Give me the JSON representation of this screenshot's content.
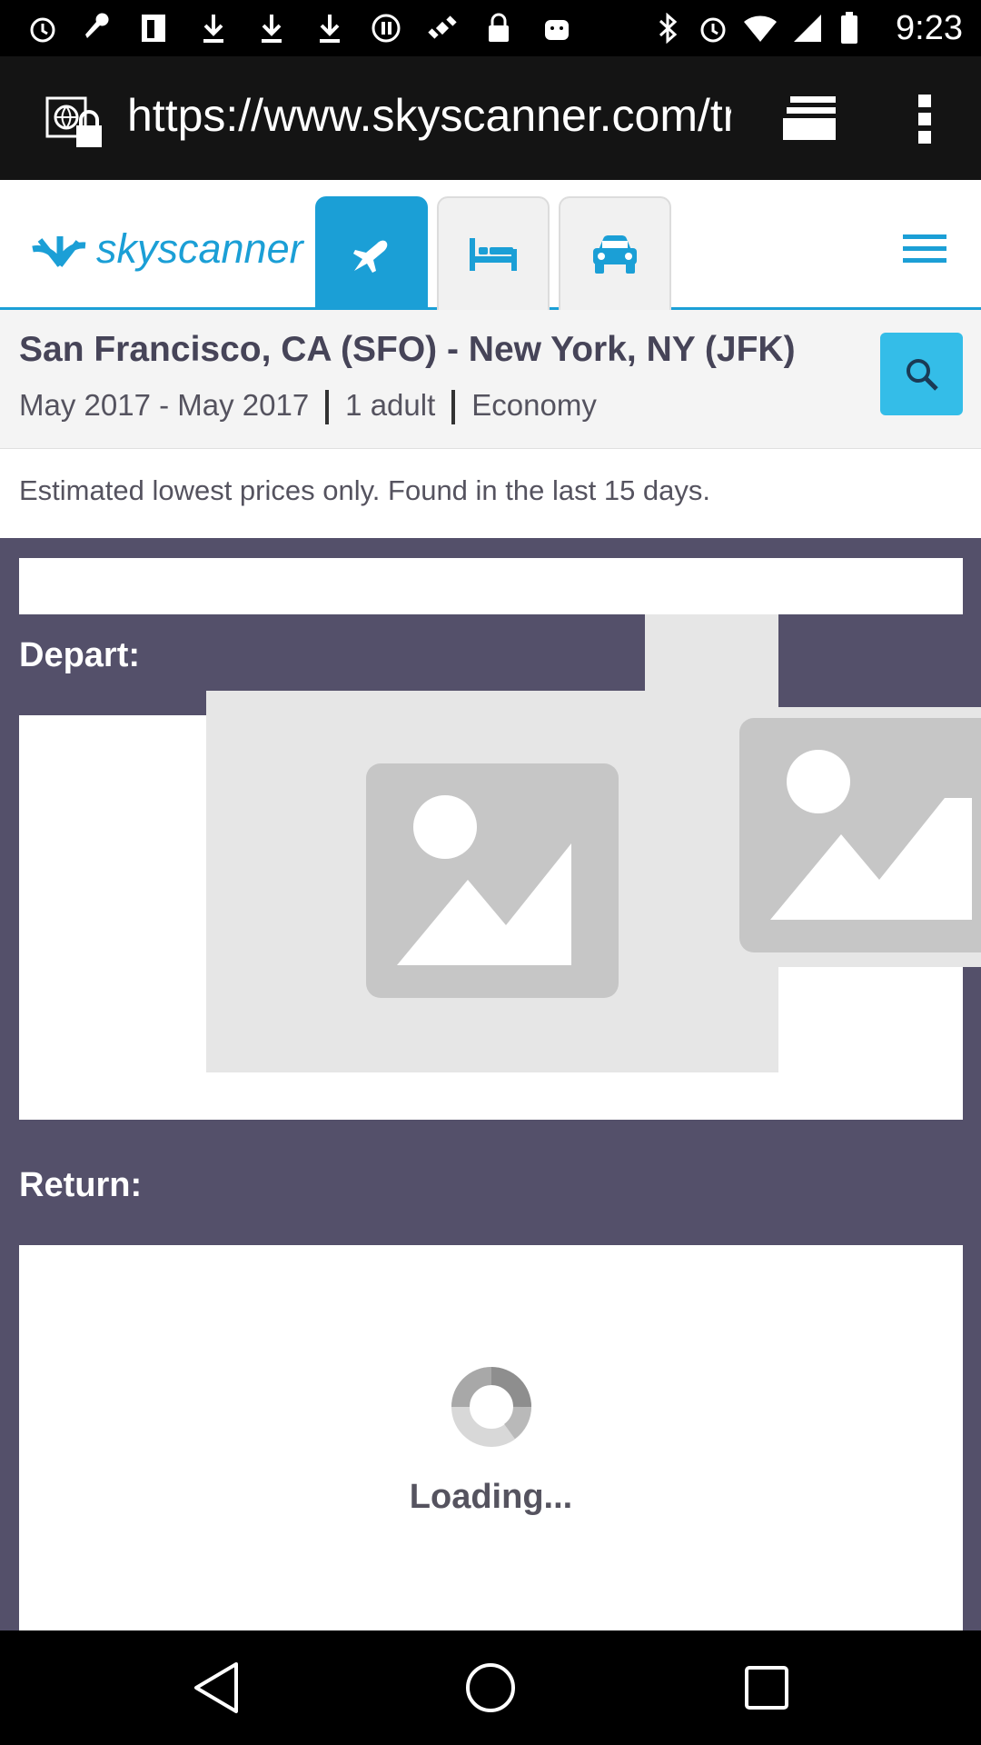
{
  "status_bar": {
    "time": "9:23"
  },
  "browser": {
    "url": "https://www.skyscanner.com/transport/flights/sfo/jfk",
    "tabs_icon": "tabs-stack-icon",
    "menu_icon": "overflow-menu-icon"
  },
  "header": {
    "logo_text": "skyscanner",
    "tabs": [
      {
        "name": "flights",
        "icon": "airplane-icon"
      },
      {
        "name": "hotels",
        "icon": "bed-icon"
      },
      {
        "name": "car-hire",
        "icon": "car-icon"
      }
    ],
    "menu_icon": "hamburger-icon"
  },
  "search": {
    "route": "San Francisco, CA (SFO) - New York, NY (JFK)",
    "dates": "May 2017 - May 2017",
    "travellers": "1 adult",
    "cabin": "Economy"
  },
  "notice": "Estimated lowest prices only. Found in the last 15 days.",
  "depart": {
    "label": "Depart:"
  },
  "return": {
    "label": "Return:",
    "loading_text": "Loading..."
  },
  "colors": {
    "brand": "#1b9fd6",
    "search_button": "#34bde8",
    "panel_bg": "#54506a"
  }
}
